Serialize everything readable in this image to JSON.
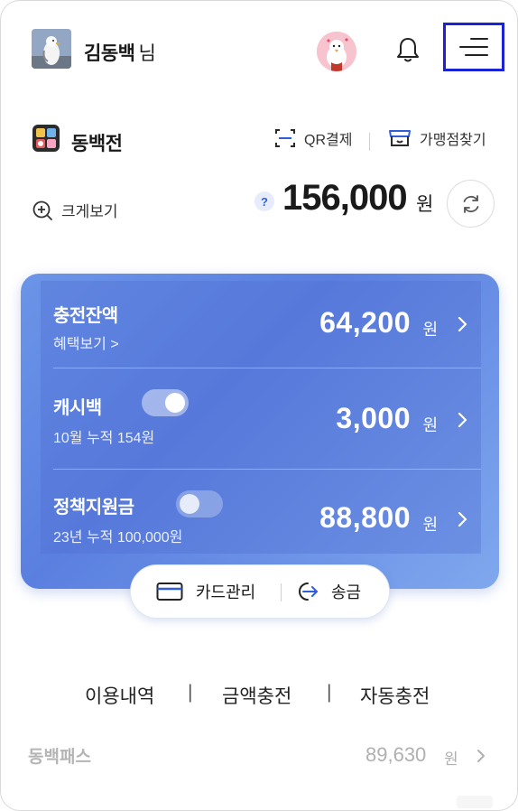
{
  "header": {
    "username": "김동백",
    "honorific": "님"
  },
  "wallet": {
    "title": "동백전",
    "qr_label": "QR결제",
    "store_label": "가맹점찾기",
    "zoom_label": "크게보기",
    "help_badge": "?",
    "total_amount": "156,000",
    "total_unit": "원"
  },
  "card": {
    "rows": [
      {
        "title": "충전잔액",
        "sub": "혜택보기 >",
        "amount": "64,200",
        "unit": "원"
      },
      {
        "title": "캐시백",
        "sub": "10월 누적 154원",
        "amount": "3,000",
        "unit": "원",
        "toggle": "on"
      },
      {
        "title": "정책지원금",
        "sub": "23년 누적 100,000원",
        "amount": "88,800",
        "unit": "원",
        "toggle": "off"
      }
    ],
    "actions": {
      "card_manage": "카드관리",
      "send": "송금"
    }
  },
  "tabs": {
    "history": "이용내역",
    "sep": "|",
    "charge": "금액충전",
    "auto_charge": "자동충전"
  },
  "pass": {
    "label": "동백패스",
    "amount": "89,630",
    "unit": "원"
  },
  "colors": {
    "accent": "#5a7fe0",
    "menu_highlight": "#1a22d6",
    "help_badge": "#2f5fd8"
  }
}
